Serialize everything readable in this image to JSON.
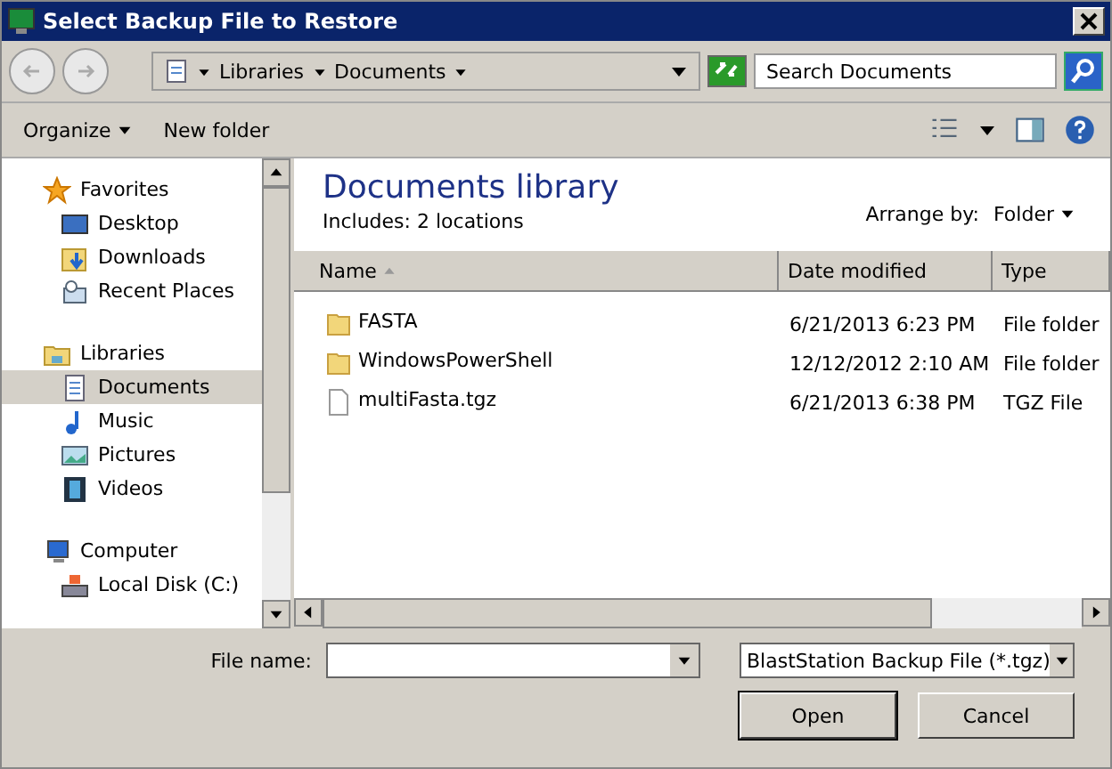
{
  "window": {
    "title": "Select Backup File to Restore"
  },
  "breadcrumb": [
    "Libraries",
    "Documents"
  ],
  "search": {
    "placeholder": "Search Documents"
  },
  "toolbar": {
    "organize": "Organize",
    "new_folder": "New folder"
  },
  "sidebar": {
    "groups": [
      {
        "label": "Favorites",
        "kind": "star",
        "items": [
          {
            "label": "Desktop",
            "kind": "desktop",
            "selected": false
          },
          {
            "label": "Downloads",
            "kind": "downloads",
            "selected": false
          },
          {
            "label": "Recent Places",
            "kind": "recent",
            "selected": false
          }
        ]
      },
      {
        "label": "Libraries",
        "kind": "library",
        "items": [
          {
            "label": "Documents",
            "kind": "document",
            "selected": true
          },
          {
            "label": "Music",
            "kind": "music",
            "selected": false
          },
          {
            "label": "Pictures",
            "kind": "pictures",
            "selected": false
          },
          {
            "label": "Videos",
            "kind": "videos",
            "selected": false
          }
        ]
      },
      {
        "label": "Computer",
        "kind": "computer",
        "items": [
          {
            "label": "Local Disk (C:)",
            "kind": "disk",
            "selected": false
          }
        ]
      }
    ]
  },
  "library": {
    "title": "Documents library",
    "includes_label": "Includes:",
    "includes_value": "2 locations",
    "arrange_label": "Arrange by:",
    "arrange_value": "Folder"
  },
  "table": {
    "columns": [
      "Name",
      "Date modified",
      "Type"
    ],
    "rows": [
      {
        "kind": "folder",
        "name": "FASTA",
        "date": "6/21/2013 6:23 PM",
        "type": "File folder"
      },
      {
        "kind": "folder",
        "name": "WindowsPowerShell",
        "date": "12/12/2012 2:10 AM",
        "type": "File folder"
      },
      {
        "kind": "file",
        "name": "multiFasta.tgz",
        "date": "6/21/2013 6:38 PM",
        "type": "TGZ File"
      }
    ]
  },
  "file_name": {
    "label": "File name:"
  },
  "file_type": {
    "value": "BlastStation Backup File (*.tgz)"
  },
  "buttons": [
    "Open",
    "Cancel"
  ]
}
